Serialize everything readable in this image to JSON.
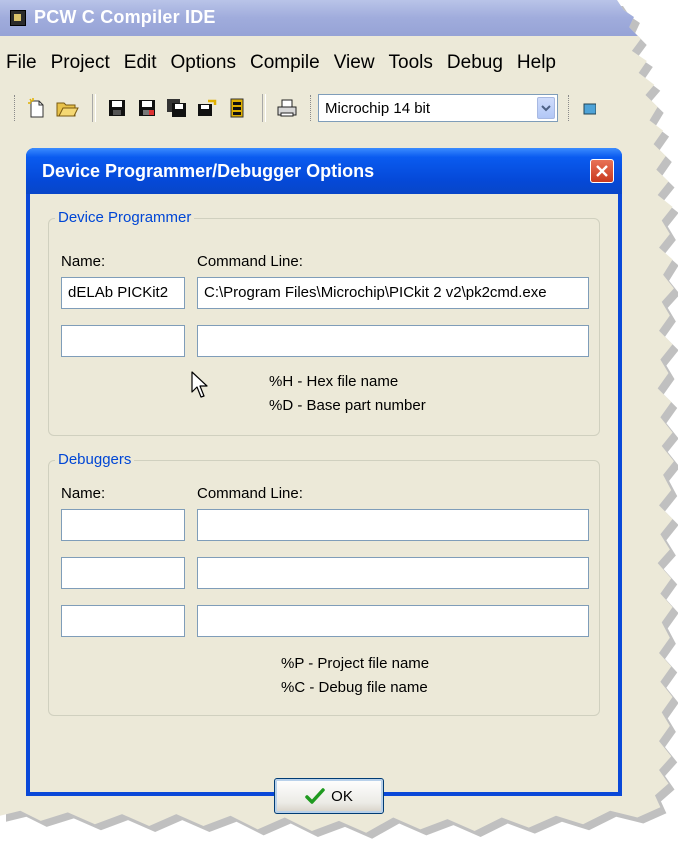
{
  "app": {
    "title": "PCW C Compiler IDE"
  },
  "menu": [
    "File",
    "Project",
    "Edit",
    "Options",
    "Compile",
    "View",
    "Tools",
    "Debug",
    "Help"
  ],
  "toolbar": {
    "icons": [
      "new-file-icon",
      "open-folder-icon",
      "save-icon",
      "save-as-icon",
      "save-all-icon",
      "close-file-icon",
      "close-all-icon",
      "print-icon"
    ],
    "device_combo": "Microchip 14 bit"
  },
  "dialog": {
    "title": "Device Programmer/Debugger Options",
    "programmer": {
      "group_title": "Device Programmer",
      "name_header": "Name:",
      "cmd_header": "Command Line:",
      "rows": [
        {
          "name": "dELAb PICKit2",
          "cmd": "C:\\Program Files\\Microchip\\PICkit 2 v2\\pk2cmd.exe"
        },
        {
          "name": "",
          "cmd": ""
        }
      ],
      "hint1": "%H - Hex file name",
      "hint2": "%D - Base part number"
    },
    "debuggers": {
      "group_title": "Debuggers",
      "name_header": "Name:",
      "cmd_header": "Command Line:",
      "rows": [
        {
          "name": "",
          "cmd": ""
        },
        {
          "name": "",
          "cmd": ""
        },
        {
          "name": "",
          "cmd": ""
        }
      ],
      "hint1": "%P - Project file name",
      "hint2": "%C - Debug file name"
    },
    "ok_label": "OK"
  },
  "colors": {
    "xp_blue": "#0549d8",
    "dialog_bg": "#ece9d8",
    "group_title": "#0046d5",
    "close_red": "#c9391f"
  }
}
